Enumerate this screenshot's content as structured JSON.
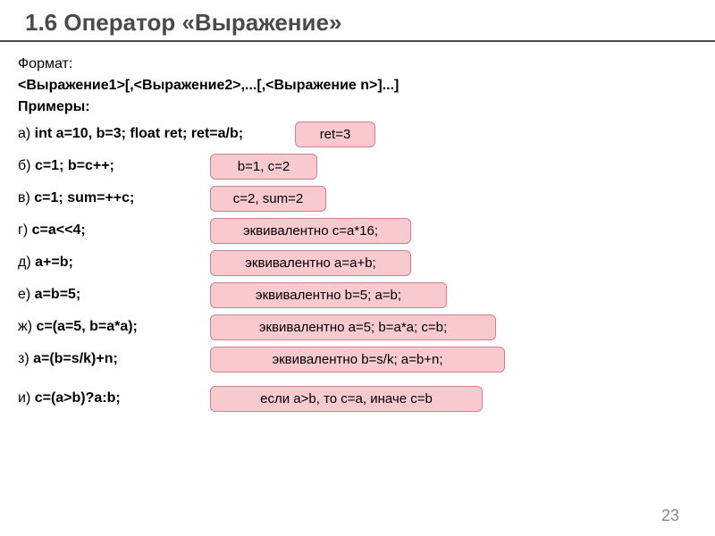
{
  "title": "1.6 Оператор «Выражение»",
  "format_label": "Формат:",
  "format_syntax": "<Выражение1>[,<Выражение2>,...[,<Выражение n>]...]",
  "examples_label": "Примеры:",
  "rows": [
    {
      "prefix": "а) ",
      "code": "int  a=10, b=3; float ret; ret=a/b;",
      "result": "ret=3"
    },
    {
      "prefix": "б) ",
      "code": "c=1;   b=c++;",
      "result": "b=1,  c=2"
    },
    {
      "prefix": "в) ",
      "code": "c=1;    sum=++c;",
      "result": "c=2, sum=2"
    },
    {
      "prefix": "г) ",
      "code": "c=a<<4;",
      "result": "эквивалентно c=a*16;"
    },
    {
      "prefix": "д) ",
      "code": "a+=b;",
      "result": "эквивалентно a=a+b;"
    },
    {
      "prefix": "е) ",
      "code": "a=b=5;",
      "result": "эквивалентно b=5; a=b;"
    },
    {
      "prefix": "ж) ",
      "code": "c=(a=5, b=a*a);",
      "result": "эквивалентно a=5; b=a*a; c=b;"
    },
    {
      "prefix": "з) ",
      "code": "a=(b=s/k)+n;",
      "result": "эквивалентно b=s/k; a=b+n;"
    },
    {
      "prefix": "и) ",
      "code": "c=(a>b)?a:b;",
      "result": "если a>b, то c=a, иначе c=b"
    }
  ],
  "page_number": "23"
}
